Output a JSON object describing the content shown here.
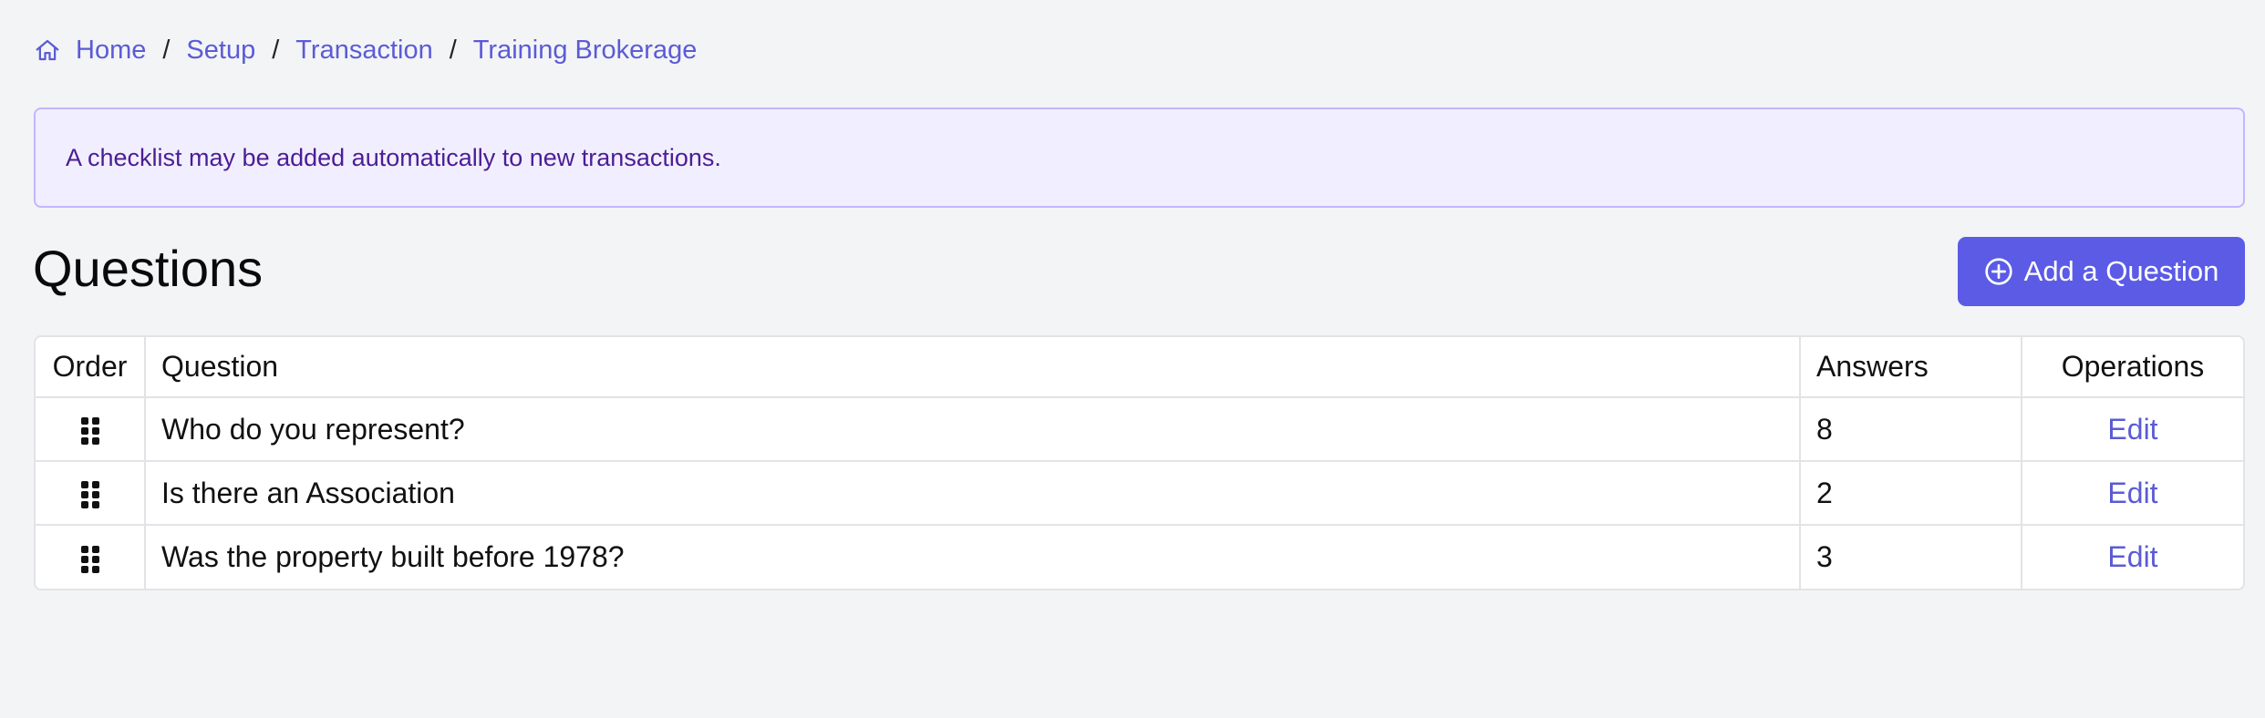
{
  "breadcrumb": {
    "icon": "home-icon",
    "items": [
      "Home",
      "Setup",
      "Transaction",
      "Training Brokerage"
    ],
    "separator": "/"
  },
  "alert": {
    "message": "A checklist may be added automatically to new transactions."
  },
  "section": {
    "title": "Questions",
    "add_button_label": "Add a Question",
    "add_button_icon": "plus-circle-icon"
  },
  "table": {
    "columns": [
      "Order",
      "Question",
      "Answers",
      "Operations"
    ],
    "rows": [
      {
        "question": "Who do you represent?",
        "answers": "8",
        "operation": "Edit"
      },
      {
        "question": "Is there an Association",
        "answers": "2",
        "operation": "Edit"
      },
      {
        "question": "Was the property built before 1978?",
        "answers": "3",
        "operation": "Edit"
      }
    ]
  },
  "colors": {
    "accent": "#5b5be6",
    "link": "#5b5bd6",
    "alert_bg": "#f1efff",
    "alert_border": "#c4b5fd",
    "alert_text": "#4c1d95",
    "page_bg": "#f3f4f6"
  }
}
